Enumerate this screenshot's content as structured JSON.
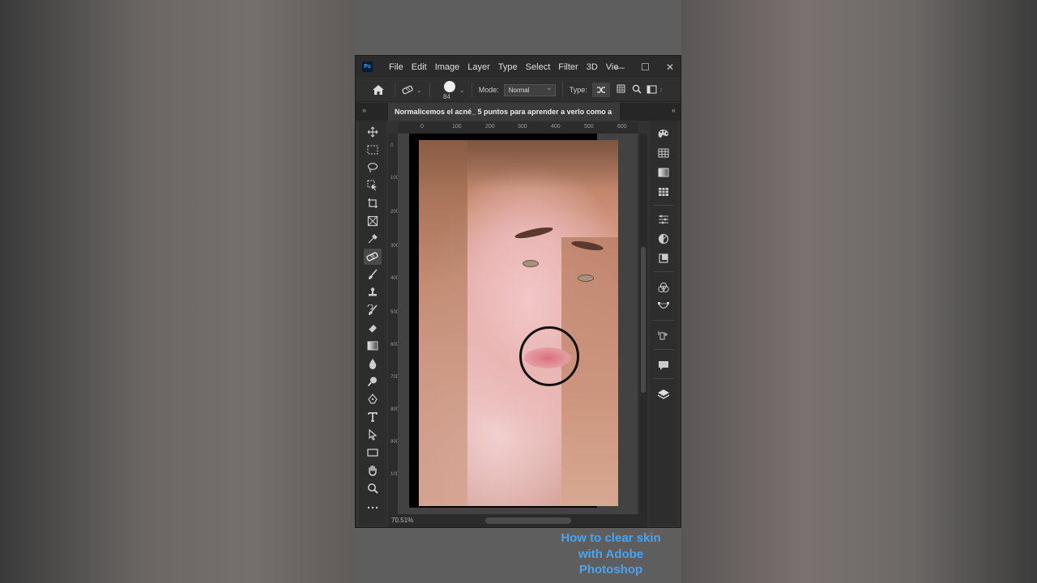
{
  "app": {
    "logo": "Ps"
  },
  "menu": {
    "items": [
      "File",
      "Edit",
      "Image",
      "Layer",
      "Type",
      "Select",
      "Filter",
      "3D",
      "Vie"
    ]
  },
  "window_controls": {
    "minimize": "—",
    "maximize": "☐",
    "close": "✕"
  },
  "options": {
    "brush_size": "84",
    "mode_label": "Mode:",
    "mode_value": "Normal",
    "type_label": "Type:"
  },
  "document": {
    "tab_title": "Normalicemos el acné_ 5 puntos para aprender a verlo como a",
    "zoom": "70.51%"
  },
  "rulers": {
    "top": [
      "0",
      "100",
      "200",
      "300",
      "400",
      "500",
      "600"
    ],
    "left": [
      "0",
      "100",
      "200",
      "300",
      "400",
      "500",
      "600",
      "700",
      "800",
      "900",
      "1000"
    ]
  },
  "caption": {
    "line1": "How to clear skin",
    "line2": "with Adobe",
    "line3": "Photoshop"
  },
  "colors": {
    "caption": "#4aa3ef",
    "app_bg": "#323232",
    "menubar": "#2b2b2b"
  }
}
